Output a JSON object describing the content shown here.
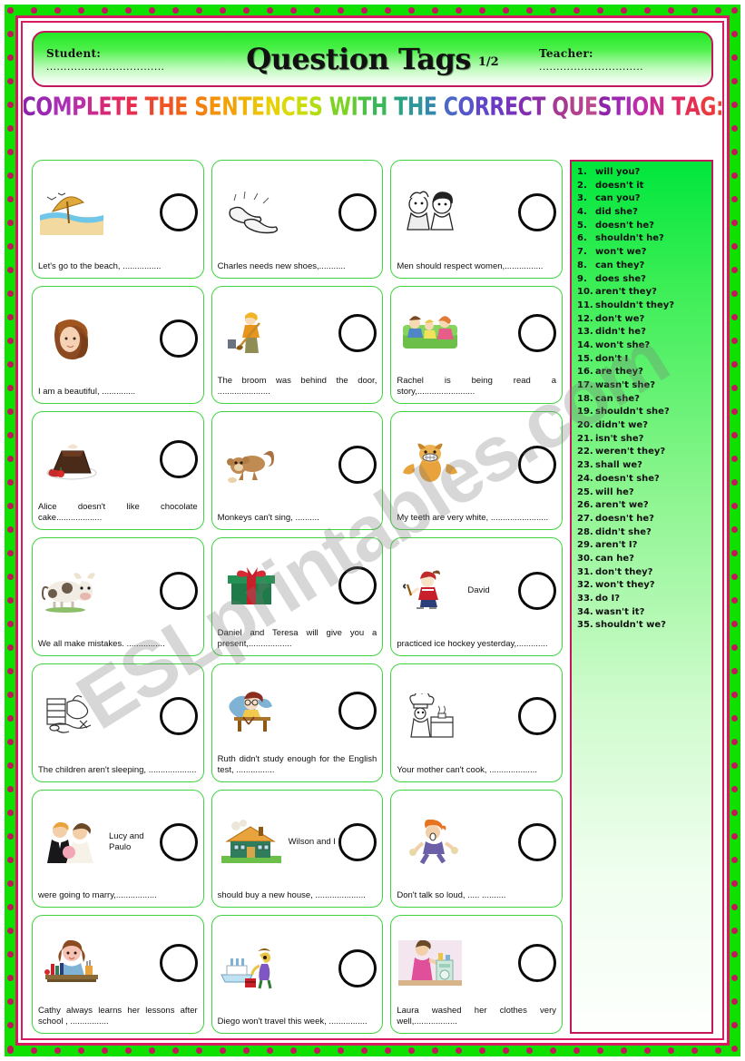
{
  "header": {
    "student_label": "Student:",
    "student_value": "..................................",
    "teacher_label": "Teacher:",
    "teacher_value": "..............................",
    "title": "Question Tags",
    "page_number": "1/2"
  },
  "instruction": {
    "text": "COMPLETE THE SENTENCES WITH THE CORRECT QUESTION TAG:",
    "colors": [
      "#8E24AA",
      "#9C27B0",
      "#AB2FB5",
      "#BA2FA5",
      "#C92B8E",
      "#D62877",
      "#E02A63",
      "#E62F50",
      "#EA3A3E",
      "#ED4630",
      "#EF5424",
      "#F0621B",
      "#F17214",
      "#F2820F",
      "#F3920B",
      "#F2A208",
      "#F0B206",
      "#EDC205",
      "#E7D005",
      "#DBDA08",
      "#C9DD0D",
      "#B2DC13",
      "#98D91A",
      "#7DD324",
      "#62CB32",
      "#4BC243",
      "#3AB858",
      "#2FAE6E",
      "#2AA385",
      "#2D979A",
      "#3389AC",
      "#3E79BB",
      "#4A68C5",
      "#5556CA",
      "#6046C9",
      "#6B3AC4",
      "#7733BB",
      "#8230B0",
      "#8E30A5",
      "#9A339A",
      "#A63A93",
      "#B2428F",
      "#BC4A90"
    ]
  },
  "exercises": [
    [
      {
        "icon": "beach-umbrella",
        "layout": "block",
        "text": "Let's   go   to   the   beach, ................"
      },
      {
        "icon": "shoes",
        "layout": "block",
        "text": "Charles      needs      new shoes,..........."
      },
      {
        "icon": "boy-girl",
        "layout": "block",
        "text": "Men     should     respect women,................"
      }
    ],
    [
      {
        "icon": "woman-face",
        "layout": "block",
        "text": "I am a beautiful, .............."
      },
      {
        "icon": "person-broom",
        "layout": "block",
        "text": "The   broom   was   behind   the door, ......................"
      },
      {
        "icon": "family-sofa",
        "layout": "block",
        "text": "Rachel   is   being   read   a story,........................"
      }
    ],
    [
      {
        "icon": "chocolate-cake",
        "layout": "block",
        "text": "Alice   doesn't   like   chocolate cake..................."
      },
      {
        "icon": "monkey",
        "layout": "block",
        "text": "Monkeys can't sing, .........."
      },
      {
        "icon": "dog-teeth",
        "layout": "block",
        "text": "My teeth are very white, ........................"
      }
    ],
    [
      {
        "icon": "cow",
        "layout": "block",
        "text": "We all make mistakes. ................"
      },
      {
        "icon": "gift-box",
        "layout": "block",
        "text": "Daniel  and  Teresa    will  give you a present,.................."
      },
      {
        "icon": "ice-hockey",
        "layout": "inline",
        "inline_text": "David",
        "text": "practiced ice hockey yesterday,............."
      }
    ],
    [
      {
        "icon": "sleeping-children",
        "layout": "block",
        "text": "The    children    aren't    sleeping, ...................."
      },
      {
        "icon": "girl-desk",
        "layout": "block",
        "text": "Ruth  didn't  study  enough  for the English test, ................"
      },
      {
        "icon": "cook",
        "layout": "block",
        "text": "Your   mother   can't   cook, ...................."
      }
    ],
    [
      {
        "icon": "wedding-couple",
        "layout": "inline",
        "inline_text": "Lucy    and    Paulo",
        "text": "were going to marry,................."
      },
      {
        "icon": "house",
        "layout": "inline",
        "inline_text": "Wilson and I",
        "text": "should buy a new house, ....................."
      },
      {
        "icon": "shouting-woman",
        "layout": "block",
        "text": "Don't talk so loud, ..... .........."
      }
    ],
    [
      {
        "icon": "girl-studying",
        "layout": "block",
        "text": "Cathy  always  learns  her  lessons after school , ................"
      },
      {
        "icon": "traveller-ship",
        "layout": "block",
        "text": "Diego  won't  travel  this  week, ................"
      },
      {
        "icon": "woman-laundry",
        "layout": "block",
        "text": "Laura washed her clothes very well,.................."
      }
    ]
  ],
  "answers": [
    {
      "num": "1.",
      "text": "will you?"
    },
    {
      "num": "2.",
      "text": "doesn't it"
    },
    {
      "num": "3.",
      "text": "can you?"
    },
    {
      "num": "4.",
      "text": "did she?"
    },
    {
      "num": "5.",
      "text": "doesn't he?"
    },
    {
      "num": "6.",
      "text": "shouldn't he?"
    },
    {
      "num": "7.",
      "text": "won't we?"
    },
    {
      "num": "8.",
      "text": "can they?"
    },
    {
      "num": "9.",
      "text": "does she?"
    },
    {
      "num": "10.",
      "text": "aren't they?"
    },
    {
      "num": "11.",
      "text": "shouldn't they?"
    },
    {
      "num": "12.",
      "text": "don't we?"
    },
    {
      "num": "13.",
      "text": "didn't he?"
    },
    {
      "num": "14.",
      "text": "won't she?"
    },
    {
      "num": "15.",
      "text": "don't I"
    },
    {
      "num": "16.",
      "text": "are they?"
    },
    {
      "num": "17.",
      "text": "wasn't she?"
    },
    {
      "num": "18.",
      "text": "can she?"
    },
    {
      "num": "19.",
      "text": "shouldn't she?"
    },
    {
      "num": "20.",
      "text": "didn't we?"
    },
    {
      "num": "21.",
      "text": "isn't she?"
    },
    {
      "num": "22.",
      "text": "weren't they?"
    },
    {
      "num": "23.",
      "text": "shall we?"
    },
    {
      "num": "24.",
      "text": "doesn't she?"
    },
    {
      "num": "25.",
      "text": "will he?"
    },
    {
      "num": "26.",
      "text": "aren't we?"
    },
    {
      "num": "27.",
      "text": "doesn't he?"
    },
    {
      "num": "28.",
      "text": "didn't she?"
    },
    {
      "num": "29.",
      "text": "aren't I?"
    },
    {
      "num": "30.",
      "text": "can he?"
    },
    {
      "num": "31.",
      "text": "don't they?"
    },
    {
      "num": "32.",
      "text": "won't they?"
    },
    {
      "num": "33.",
      "text": "do I?"
    },
    {
      "num": "34.",
      "text": "wasn't it?"
    },
    {
      "num": "35.",
      "text": "shouldn't we?"
    }
  ],
  "watermark": {
    "text": "ESLprintables.com"
  }
}
